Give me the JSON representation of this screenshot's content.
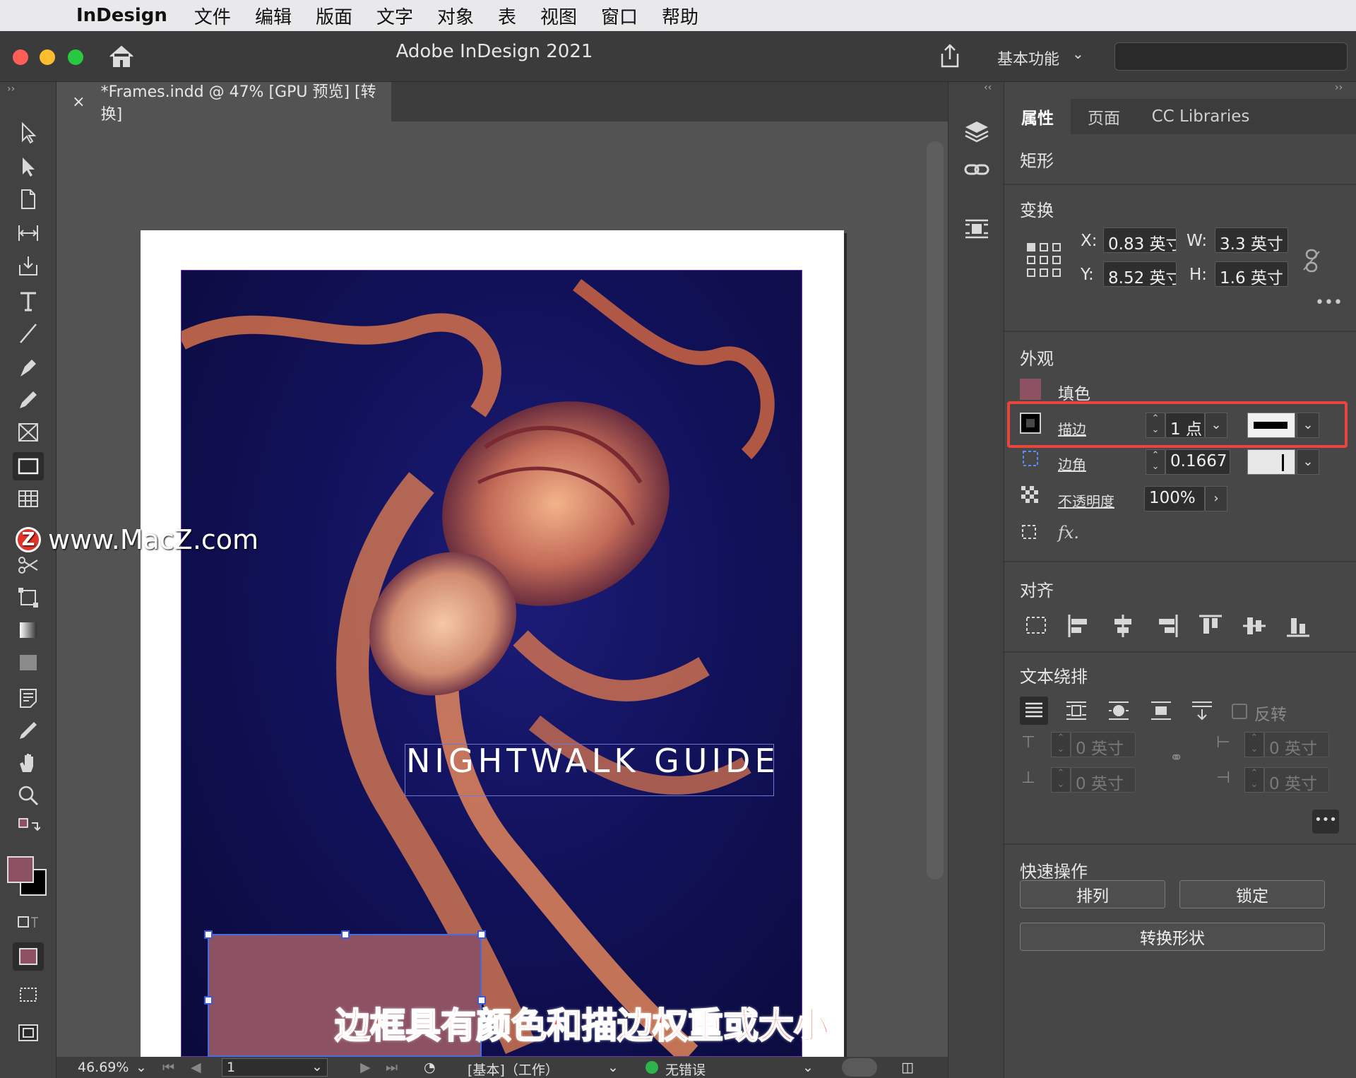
{
  "menubar": {
    "app_name": "InDesign",
    "items": [
      "文件",
      "编辑",
      "版面",
      "文字",
      "对象",
      "表",
      "视图",
      "窗口",
      "帮助"
    ]
  },
  "titlebar": {
    "title": "Adobe InDesign 2021",
    "workspace": "基本功能"
  },
  "document": {
    "tab_label": "*Frames.indd @ 47% [GPU 预览] [转换]",
    "close_symbol": "×",
    "headline": "NIGHTWALK GUIDE"
  },
  "watermark": {
    "logo_letter": "Z",
    "text": "www.MacZ.com"
  },
  "caption": "边框具有颜色和描边权重或大小",
  "statusbar": {
    "zoom": "46.69%",
    "page": "1",
    "profile": "[基本]（工作）",
    "preflight": "无错误",
    "preflight_color": "#2fb44b"
  },
  "panel": {
    "tabs": [
      "属性",
      "页面",
      "CC Libraries"
    ],
    "object_type": "矩形",
    "transform": {
      "title": "变换",
      "x_label": "X:",
      "x_value": "0.83 英寸",
      "y_label": "Y:",
      "y_value": "8.52 英寸",
      "w_label": "W:",
      "w_value": "3.3 英寸",
      "h_label": "H:",
      "h_value": "1.6 英寸"
    },
    "appearance": {
      "title": "外观",
      "fill_label": "填色",
      "fill_color": "#8c5264",
      "stroke_label": "描边",
      "stroke_weight": "1 点",
      "corner_label": "边角",
      "corner_value": "0.1667",
      "opacity_label": "不透明度",
      "opacity_value": "100%",
      "fx_label": "fx."
    },
    "align": {
      "title": "对齐"
    },
    "text_wrap": {
      "title": "文本绕排",
      "invert_label": "反转",
      "top_offset": "0 英寸",
      "bottom_offset": "0 英寸",
      "left_offset": "0 英寸",
      "right_offset": "0 英寸"
    },
    "quick_actions": {
      "title": "快速操作",
      "arrange": "排列",
      "lock": "锁定",
      "convert_shape": "转换形状"
    }
  },
  "colors": {
    "accent_highlight": "#e8453c",
    "selection": "#3a5ad8"
  }
}
